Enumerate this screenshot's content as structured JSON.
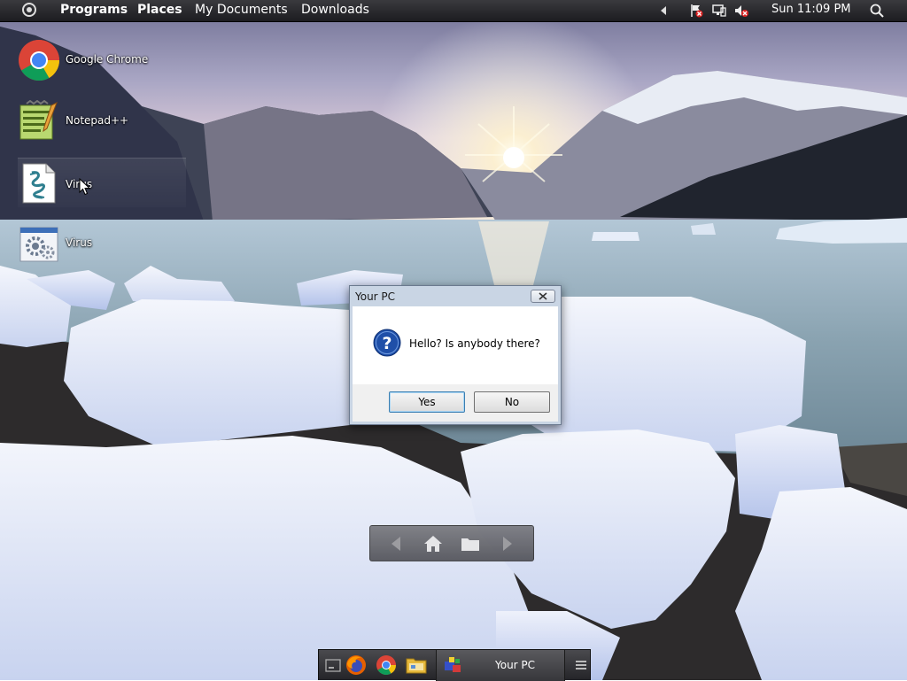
{
  "top_panel": {
    "menus": [
      "Programs",
      "Places",
      "My Documents",
      "Downloads"
    ],
    "clock": "Sun 11:09 PM"
  },
  "desktop": {
    "icons": [
      {
        "label": "Google Chrome",
        "icon": "chrome-icon"
      },
      {
        "label": "Notepad++",
        "icon": "notepad-plus-plus-icon"
      },
      {
        "label": "Virus",
        "icon": "script-file-icon"
      },
      {
        "label": "Virus",
        "icon": "settings-file-icon"
      }
    ]
  },
  "dialog": {
    "title": "Your PC",
    "message": "Hello? Is anybody there?",
    "yes_label": "Yes",
    "no_label": "No"
  },
  "dock": {
    "task_label": "Your PC"
  },
  "colors": {
    "panel": "#2a2a2e",
    "dialog_frame": "#c9d5e4",
    "accent_blue": "#1f4fa8"
  }
}
